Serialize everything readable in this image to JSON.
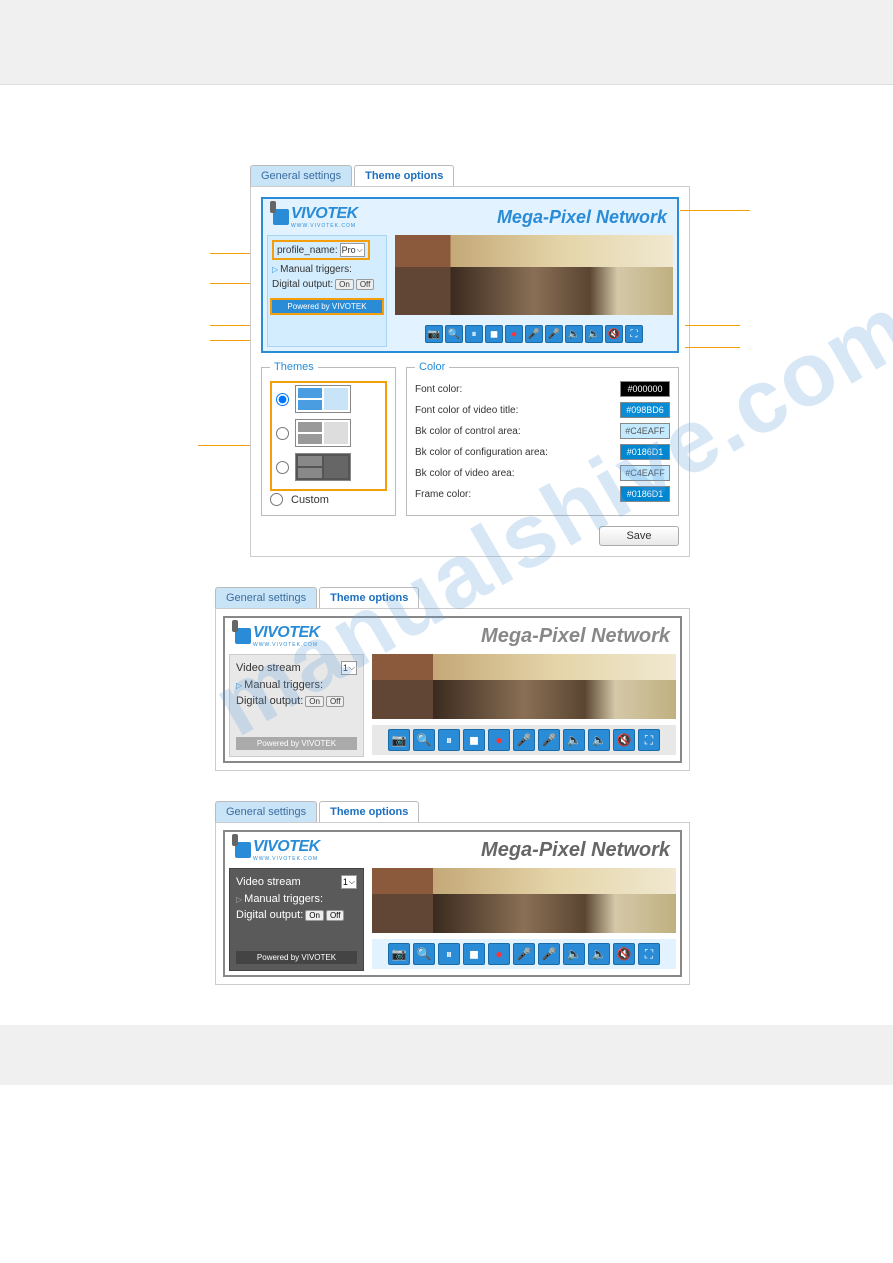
{
  "header": {},
  "watermark": "manualshive.com",
  "tabs": {
    "general": "General settings",
    "theme": "Theme options"
  },
  "logo": {
    "text": "VIVOTEK",
    "sub": "WWW.VIVOTEK.COM"
  },
  "page_title": "Mega-Pixel Network",
  "panel1": {
    "profile_label": "profile_name:",
    "profile_value": "Pro",
    "manual_triggers": "Manual triggers:",
    "digital_output": "Digital output:",
    "btn_on": "On",
    "btn_off": "Off",
    "powered_by": "Powered by VIVOTEK"
  },
  "panel23": {
    "video_stream": "Video stream",
    "stream_value": "1",
    "manual_triggers": "Manual triggers:",
    "digital_output": "Digital output:",
    "btn_on": "On",
    "btn_off": "Off",
    "powered_by": "Powered by VIVOTEK"
  },
  "toolbar_icons": [
    "camera-icon",
    "zoom-icon",
    "pause-icon",
    "stop-icon",
    "record-icon",
    "mic-down-icon",
    "mic-icon",
    "speaker-icon",
    "speaker-down-icon",
    "speaker-mute-icon",
    "fullscreen-icon"
  ],
  "toolbar_glyphs": [
    "📷",
    "🔍",
    "⏸",
    "◼",
    "●",
    "🎤",
    "🎤",
    "🔈",
    "🔈",
    "🔇",
    "⛶"
  ],
  "themes": {
    "legend": "Themes",
    "custom": "Custom"
  },
  "color": {
    "legend": "Color",
    "rows": [
      {
        "label": "Font color:",
        "value": "#000000",
        "bg": "#000000",
        "fg": "#ffffff"
      },
      {
        "label": "Font color of video title:",
        "value": "#098BD6",
        "bg": "#098BD6",
        "fg": "#ffffff"
      },
      {
        "label": "Bk color of control area:",
        "value": "#C4EAFF",
        "bg": "#C4EAFF",
        "fg": "#555555"
      },
      {
        "label": "Bk color of configuration area:",
        "value": "#0186D1",
        "bg": "#0186D1",
        "fg": "#ffffff"
      },
      {
        "label": "Bk color of video area:",
        "value": "#C4EAFF",
        "bg": "#C4EAFF",
        "fg": "#555555"
      },
      {
        "label": "Frame color:",
        "value": "#0186D1",
        "bg": "#0186D1",
        "fg": "#ffffff"
      }
    ]
  },
  "save_label": "Save"
}
